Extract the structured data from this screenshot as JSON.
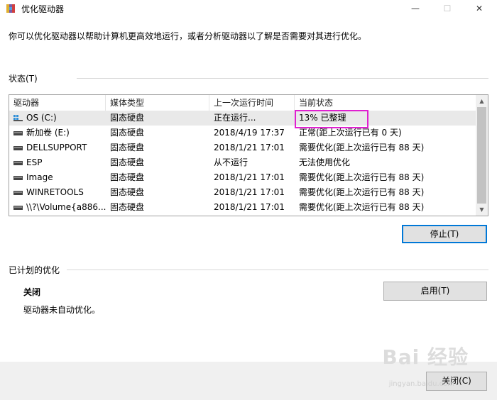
{
  "window": {
    "title": "优化驱动器",
    "minimize": "—",
    "maximize": "☐",
    "close": "✕"
  },
  "description": "你可以优化驱动器以帮助计算机更高效地运行，或者分析驱动器以了解是否需要对其进行优化。",
  "status_section": {
    "label": "状态(T)",
    "columns": [
      "驱动器",
      "媒体类型",
      "上一次运行时间",
      "当前状态"
    ],
    "rows": [
      {
        "drive": "OS (C:)",
        "media": "固态硬盘",
        "last_run": "正在运行...",
        "status": "13% 已整理",
        "icon": "os-drive-icon"
      },
      {
        "drive": "新加卷 (E:)",
        "media": "固态硬盘",
        "last_run": "2018/4/19 17:37",
        "status": "正常(距上次运行已有 0 天)",
        "icon": "drive-icon"
      },
      {
        "drive": "DELLSUPPORT",
        "media": "固态硬盘",
        "last_run": "2018/1/21 17:01",
        "status": "需要优化(距上次运行已有 88 天)",
        "icon": "drive-icon"
      },
      {
        "drive": "ESP",
        "media": "固态硬盘",
        "last_run": "从不运行",
        "status": "无法使用优化",
        "icon": "drive-icon"
      },
      {
        "drive": "Image",
        "media": "固态硬盘",
        "last_run": "2018/1/21 17:01",
        "status": "需要优化(距上次运行已有 88 天)",
        "icon": "drive-icon"
      },
      {
        "drive": "WINRETOOLS",
        "media": "固态硬盘",
        "last_run": "2018/1/21 17:01",
        "status": "需要优化(距上次运行已有 88 天)",
        "icon": "drive-icon"
      },
      {
        "drive": "\\\\?\\Volume{a886...",
        "media": "固态硬盘",
        "last_run": "2018/1/21 17:01",
        "status": "需要优化(距上次运行已有 88 天)",
        "icon": "drive-icon"
      }
    ],
    "stop_button": "停止(T)"
  },
  "scheduled_section": {
    "label": "已计划的优化",
    "state": "关闭",
    "detail": "驱动器未自动优化。",
    "enable_button": "启用(T)"
  },
  "footer": {
    "close_button": "关闭(C)"
  },
  "watermark": {
    "text": "Bai 经验",
    "sub": "jingyan.baidu.com"
  },
  "colors": {
    "highlight_border": "#e020d0",
    "default_button_border": "#0078d7"
  }
}
